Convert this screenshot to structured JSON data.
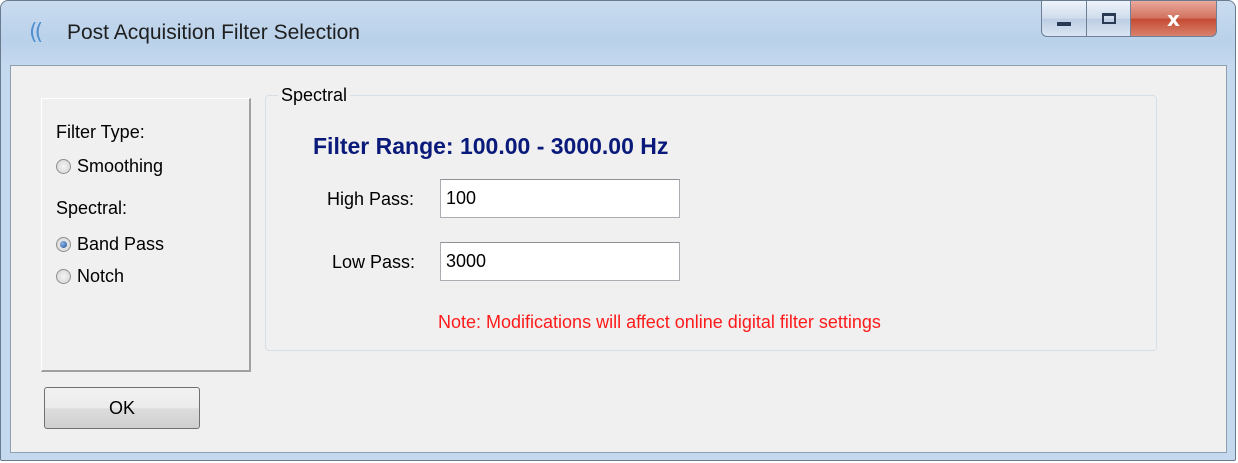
{
  "window": {
    "title": "Post Acquisition Filter Selection",
    "app_icon": "((",
    "controls": {
      "minimize": "minimize-icon",
      "maximize": "maximize-icon",
      "close": "x"
    }
  },
  "left_panel": {
    "filter_type_label": "Filter Type:",
    "smoothing_label": "Smoothing",
    "spectral_label": "Spectral:",
    "band_pass_label": "Band Pass",
    "notch_label": "Notch",
    "selected": "Band Pass"
  },
  "ok_button": "OK",
  "spectral_group": {
    "title": "Spectral",
    "filter_range": "Filter Range: 100.00 - 3000.00 Hz",
    "high_pass_label": "High Pass:",
    "high_pass_value": "100",
    "low_pass_label": "Low Pass:",
    "low_pass_value": "3000",
    "note": "Note: Modifications will affect online digital filter settings"
  },
  "colors": {
    "filter_range_text": "#0a1a7a",
    "note_text": "#ff1a1a",
    "title_bar": "#b9d1ea",
    "client_bg": "#f0f0f0"
  }
}
